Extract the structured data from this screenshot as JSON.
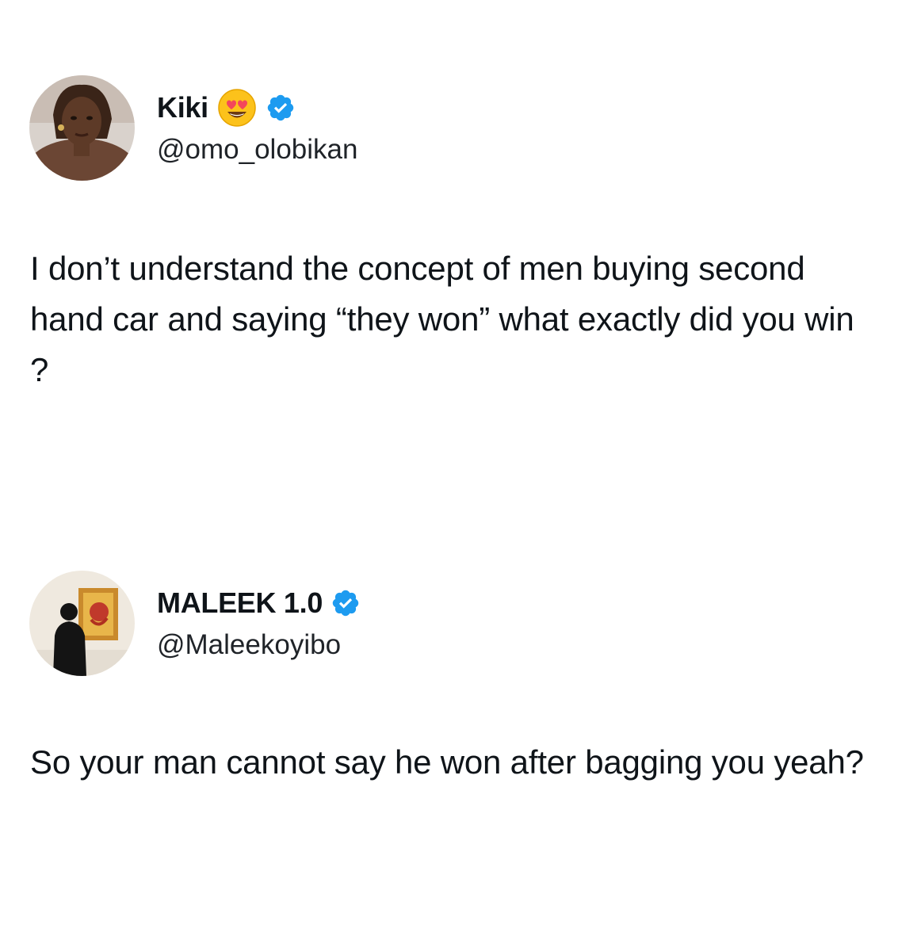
{
  "tweets": [
    {
      "display_name": "Kiki",
      "emoji_icon": "heart-eyes-emoji-icon",
      "verified_icon": "verified-badge-icon",
      "handle": "@omo_olobikan",
      "text": "I don’t understand the concept of men buying second hand car and saying “they won” what exactly did you win ?"
    },
    {
      "display_name": "MALEEK 1.0",
      "verified_icon": "verified-badge-icon",
      "handle": "@Maleekoyibo",
      "text": "So your man cannot say he won after bagging you yeah?"
    }
  ],
  "colors": {
    "text": "#0f1419",
    "verified_blue": "#1d9bf0",
    "background": "#ffffff"
  }
}
